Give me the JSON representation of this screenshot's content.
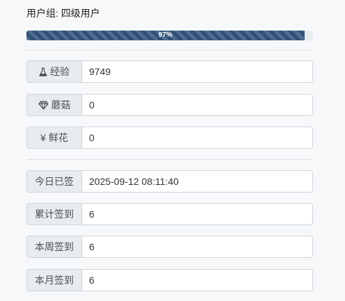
{
  "user_group": {
    "text": "用户组: 四级用户"
  },
  "progress": {
    "percent": 97,
    "label": "97%"
  },
  "stats": {
    "experience": {
      "icon": "flask-icon",
      "label": "经验",
      "value": "9749"
    },
    "mushroom": {
      "icon": "diamond-icon",
      "label": "蘑菇",
      "value": "0"
    },
    "flower": {
      "icon": "yen-icon",
      "glyph": "¥",
      "label": "鲜花",
      "value": "0"
    }
  },
  "signin": {
    "today": {
      "label": "今日已签",
      "value": "2025-09-12 08:11:40"
    },
    "total": {
      "label": "累计签到",
      "value": "6"
    },
    "week": {
      "label": "本周签到",
      "value": "6"
    },
    "month": {
      "label": "本月签到",
      "value": "6"
    }
  },
  "colors": {
    "progress_fill": "#2f5078",
    "progress_track": "#e9ecef",
    "label_bg": "#e9ecef",
    "border": "#ced4da"
  }
}
